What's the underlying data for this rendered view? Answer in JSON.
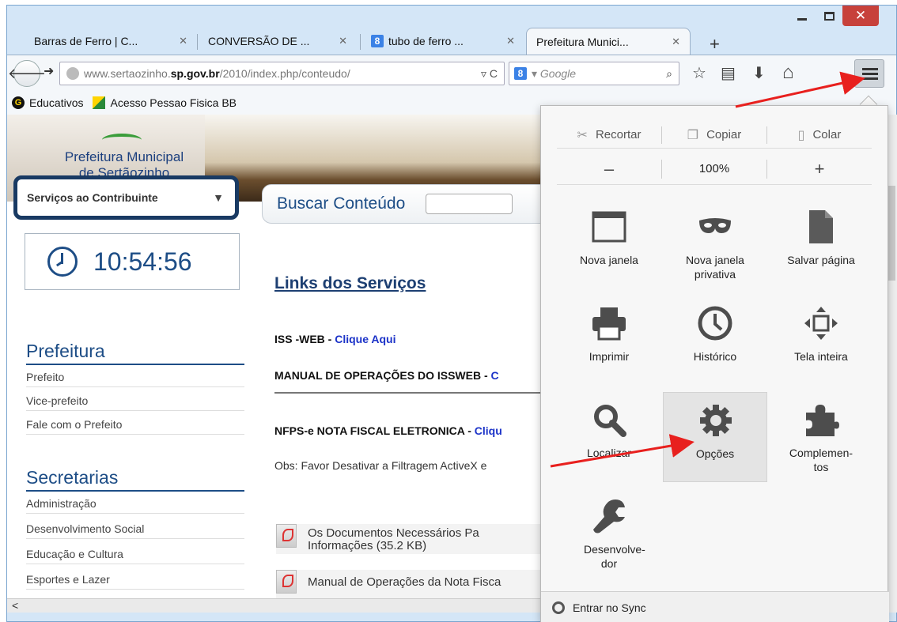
{
  "window": {
    "close_symbol": "✕"
  },
  "tabs": [
    {
      "label": "Barras de Ferro | C...",
      "close": "✕"
    },
    {
      "label": "CONVERSÃO DE ...",
      "close": "✕"
    },
    {
      "label": "tubo de ferro ...",
      "close": "✕",
      "favicon": "8"
    },
    {
      "label": "Prefeitura Munici...",
      "close": "✕",
      "active": true
    }
  ],
  "newtab_symbol": "+",
  "toolbar": {
    "url_prefix": "www.sertaozinho.",
    "url_domain": "sp.gov.br",
    "url_path": "/2010/index.php/conteudo/",
    "url_controls": "▿ C",
    "search_engine_badge": "8",
    "search_placeholder": "▾ Google",
    "search_icon": "⌕"
  },
  "bookmarks": [
    {
      "label": "Educativos",
      "icon": "G"
    },
    {
      "label": "Acesso Pessao Fisica BB"
    }
  ],
  "site": {
    "logo_line1": "Prefeitura Municipal",
    "logo_line2": "de Sertãozinho",
    "servicos_select": "Serviços ao Contribuinte",
    "servicos_arrow": "▼",
    "buscar_label": "Buscar Conteúdo",
    "clock_time": "10:54:56",
    "prefeitura_title": "Prefeitura",
    "prefeitura_items": [
      "Prefeito",
      "Vice-prefeito",
      "Fale com o Prefeito"
    ],
    "secretarias_title": "Secretarias",
    "secretarias_items": [
      "Administração",
      "Desenvolvimento Social",
      "Educação e Cultura",
      "Esportes e Lazer"
    ],
    "links_title": "Links dos Serviços",
    "iss_label": "ISS -WEB - ",
    "iss_link": "Clique Aqui",
    "manual_label": "MANUAL DE OPERAÇÕES DO ISSWEB - ",
    "manual_link": "C",
    "nfps_label": "NFPS-e NOTA FISCAL ELETRONICA - ",
    "nfps_link": "Cliqu",
    "obs_text": "Obs: Favor Desativar a Filtragem ActiveX e",
    "doc1_line1": "Os  Documentos  Necessários  Pa",
    "doc1_line2": "Informações (35.2 KB)",
    "doc2_line1": "Manual de Operações da Nota Fisca",
    "scroll_left": "<"
  },
  "menu": {
    "cut": "Recortar",
    "copy": "Copiar",
    "paste": "Colar",
    "zoom_out": "–",
    "zoom_level": "100%",
    "zoom_in": "+",
    "items": [
      {
        "label": "Nova janela"
      },
      {
        "label": "Nova janela privativa"
      },
      {
        "label": "Salvar página"
      },
      {
        "label": "Imprimir"
      },
      {
        "label": "Histórico"
      },
      {
        "label": "Tela inteira"
      },
      {
        "label": "Localizar"
      },
      {
        "label": "Opções"
      },
      {
        "label": "Complemen-tos"
      },
      {
        "label": "Desenvolve-dor"
      }
    ],
    "sync": "Entrar no Sync"
  },
  "annotation_color": "#e8201e"
}
